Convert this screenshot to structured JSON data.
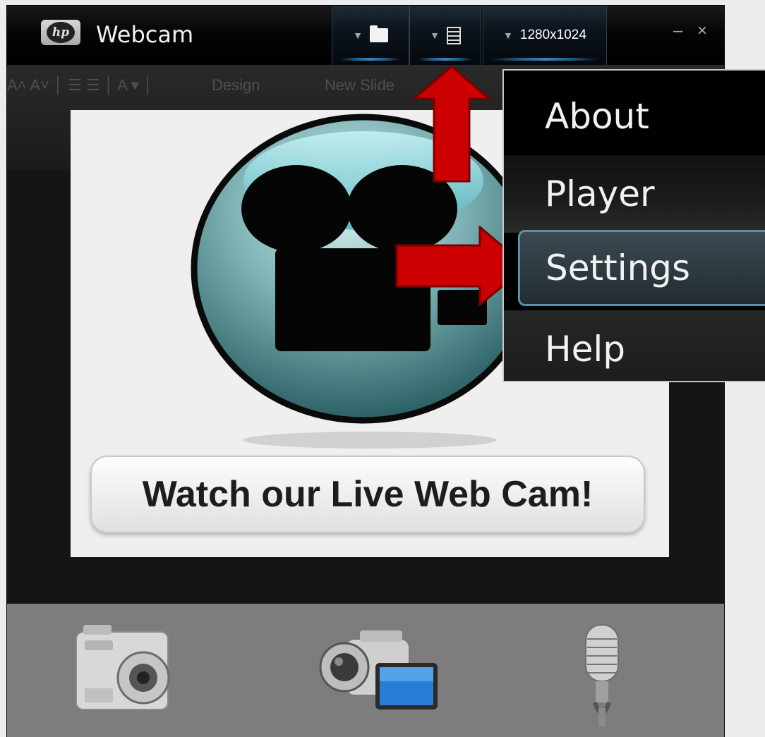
{
  "window": {
    "title": "Webcam",
    "logo_text": "hp",
    "resolution": "1280x1024",
    "minimize_glyph": "–",
    "close_glyph": "×"
  },
  "background_toolbar": {
    "design_label": "Design",
    "new_slide_label": "New Slide"
  },
  "preview": {
    "button_label": "Watch our Live Web Cam!"
  },
  "menu": {
    "items": [
      {
        "label": "About"
      },
      {
        "label": "Player"
      },
      {
        "label": "Settings",
        "highlighted": true
      },
      {
        "label": "Help"
      }
    ]
  },
  "bottom_tools": [
    {
      "icon": "photo-camera-icon"
    },
    {
      "icon": "video-camera-icon"
    },
    {
      "icon": "microphone-icon"
    }
  ],
  "colors": {
    "accent_blue": "#4aa3e0",
    "arrow_red": "#d40000",
    "highlight_border": "#5a8fa8",
    "bottom_bar": "#7d7d7d"
  }
}
